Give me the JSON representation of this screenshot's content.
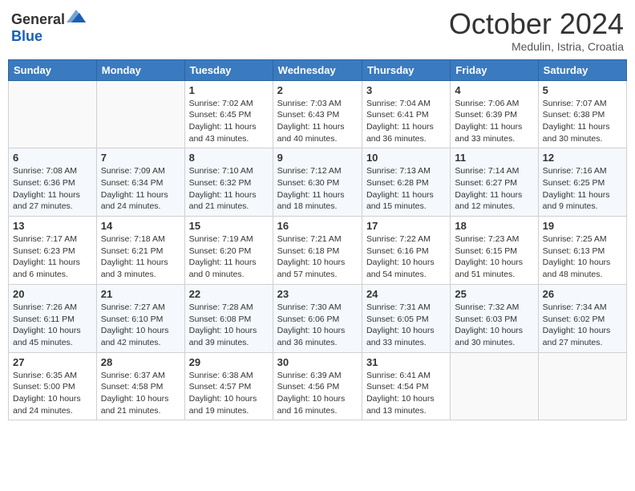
{
  "header": {
    "logo_general": "General",
    "logo_blue": "Blue",
    "month": "October 2024",
    "location": "Medulin, Istria, Croatia"
  },
  "days_of_week": [
    "Sunday",
    "Monday",
    "Tuesday",
    "Wednesday",
    "Thursday",
    "Friday",
    "Saturday"
  ],
  "weeks": [
    [
      {
        "day": "",
        "sunrise": "",
        "sunset": "",
        "daylight": ""
      },
      {
        "day": "",
        "sunrise": "",
        "sunset": "",
        "daylight": ""
      },
      {
        "day": "1",
        "sunrise": "Sunrise: 7:02 AM",
        "sunset": "Sunset: 6:45 PM",
        "daylight": "Daylight: 11 hours and 43 minutes."
      },
      {
        "day": "2",
        "sunrise": "Sunrise: 7:03 AM",
        "sunset": "Sunset: 6:43 PM",
        "daylight": "Daylight: 11 hours and 40 minutes."
      },
      {
        "day": "3",
        "sunrise": "Sunrise: 7:04 AM",
        "sunset": "Sunset: 6:41 PM",
        "daylight": "Daylight: 11 hours and 36 minutes."
      },
      {
        "day": "4",
        "sunrise": "Sunrise: 7:06 AM",
        "sunset": "Sunset: 6:39 PM",
        "daylight": "Daylight: 11 hours and 33 minutes."
      },
      {
        "day": "5",
        "sunrise": "Sunrise: 7:07 AM",
        "sunset": "Sunset: 6:38 PM",
        "daylight": "Daylight: 11 hours and 30 minutes."
      }
    ],
    [
      {
        "day": "6",
        "sunrise": "Sunrise: 7:08 AM",
        "sunset": "Sunset: 6:36 PM",
        "daylight": "Daylight: 11 hours and 27 minutes."
      },
      {
        "day": "7",
        "sunrise": "Sunrise: 7:09 AM",
        "sunset": "Sunset: 6:34 PM",
        "daylight": "Daylight: 11 hours and 24 minutes."
      },
      {
        "day": "8",
        "sunrise": "Sunrise: 7:10 AM",
        "sunset": "Sunset: 6:32 PM",
        "daylight": "Daylight: 11 hours and 21 minutes."
      },
      {
        "day": "9",
        "sunrise": "Sunrise: 7:12 AM",
        "sunset": "Sunset: 6:30 PM",
        "daylight": "Daylight: 11 hours and 18 minutes."
      },
      {
        "day": "10",
        "sunrise": "Sunrise: 7:13 AM",
        "sunset": "Sunset: 6:28 PM",
        "daylight": "Daylight: 11 hours and 15 minutes."
      },
      {
        "day": "11",
        "sunrise": "Sunrise: 7:14 AM",
        "sunset": "Sunset: 6:27 PM",
        "daylight": "Daylight: 11 hours and 12 minutes."
      },
      {
        "day": "12",
        "sunrise": "Sunrise: 7:16 AM",
        "sunset": "Sunset: 6:25 PM",
        "daylight": "Daylight: 11 hours and 9 minutes."
      }
    ],
    [
      {
        "day": "13",
        "sunrise": "Sunrise: 7:17 AM",
        "sunset": "Sunset: 6:23 PM",
        "daylight": "Daylight: 11 hours and 6 minutes."
      },
      {
        "day": "14",
        "sunrise": "Sunrise: 7:18 AM",
        "sunset": "Sunset: 6:21 PM",
        "daylight": "Daylight: 11 hours and 3 minutes."
      },
      {
        "day": "15",
        "sunrise": "Sunrise: 7:19 AM",
        "sunset": "Sunset: 6:20 PM",
        "daylight": "Daylight: 11 hours and 0 minutes."
      },
      {
        "day": "16",
        "sunrise": "Sunrise: 7:21 AM",
        "sunset": "Sunset: 6:18 PM",
        "daylight": "Daylight: 10 hours and 57 minutes."
      },
      {
        "day": "17",
        "sunrise": "Sunrise: 7:22 AM",
        "sunset": "Sunset: 6:16 PM",
        "daylight": "Daylight: 10 hours and 54 minutes."
      },
      {
        "day": "18",
        "sunrise": "Sunrise: 7:23 AM",
        "sunset": "Sunset: 6:15 PM",
        "daylight": "Daylight: 10 hours and 51 minutes."
      },
      {
        "day": "19",
        "sunrise": "Sunrise: 7:25 AM",
        "sunset": "Sunset: 6:13 PM",
        "daylight": "Daylight: 10 hours and 48 minutes."
      }
    ],
    [
      {
        "day": "20",
        "sunrise": "Sunrise: 7:26 AM",
        "sunset": "Sunset: 6:11 PM",
        "daylight": "Daylight: 10 hours and 45 minutes."
      },
      {
        "day": "21",
        "sunrise": "Sunrise: 7:27 AM",
        "sunset": "Sunset: 6:10 PM",
        "daylight": "Daylight: 10 hours and 42 minutes."
      },
      {
        "day": "22",
        "sunrise": "Sunrise: 7:28 AM",
        "sunset": "Sunset: 6:08 PM",
        "daylight": "Daylight: 10 hours and 39 minutes."
      },
      {
        "day": "23",
        "sunrise": "Sunrise: 7:30 AM",
        "sunset": "Sunset: 6:06 PM",
        "daylight": "Daylight: 10 hours and 36 minutes."
      },
      {
        "day": "24",
        "sunrise": "Sunrise: 7:31 AM",
        "sunset": "Sunset: 6:05 PM",
        "daylight": "Daylight: 10 hours and 33 minutes."
      },
      {
        "day": "25",
        "sunrise": "Sunrise: 7:32 AM",
        "sunset": "Sunset: 6:03 PM",
        "daylight": "Daylight: 10 hours and 30 minutes."
      },
      {
        "day": "26",
        "sunrise": "Sunrise: 7:34 AM",
        "sunset": "Sunset: 6:02 PM",
        "daylight": "Daylight: 10 hours and 27 minutes."
      }
    ],
    [
      {
        "day": "27",
        "sunrise": "Sunrise: 6:35 AM",
        "sunset": "Sunset: 5:00 PM",
        "daylight": "Daylight: 10 hours and 24 minutes."
      },
      {
        "day": "28",
        "sunrise": "Sunrise: 6:37 AM",
        "sunset": "Sunset: 4:58 PM",
        "daylight": "Daylight: 10 hours and 21 minutes."
      },
      {
        "day": "29",
        "sunrise": "Sunrise: 6:38 AM",
        "sunset": "Sunset: 4:57 PM",
        "daylight": "Daylight: 10 hours and 19 minutes."
      },
      {
        "day": "30",
        "sunrise": "Sunrise: 6:39 AM",
        "sunset": "Sunset: 4:56 PM",
        "daylight": "Daylight: 10 hours and 16 minutes."
      },
      {
        "day": "31",
        "sunrise": "Sunrise: 6:41 AM",
        "sunset": "Sunset: 4:54 PM",
        "daylight": "Daylight: 10 hours and 13 minutes."
      },
      {
        "day": "",
        "sunrise": "",
        "sunset": "",
        "daylight": ""
      },
      {
        "day": "",
        "sunrise": "",
        "sunset": "",
        "daylight": ""
      }
    ]
  ]
}
